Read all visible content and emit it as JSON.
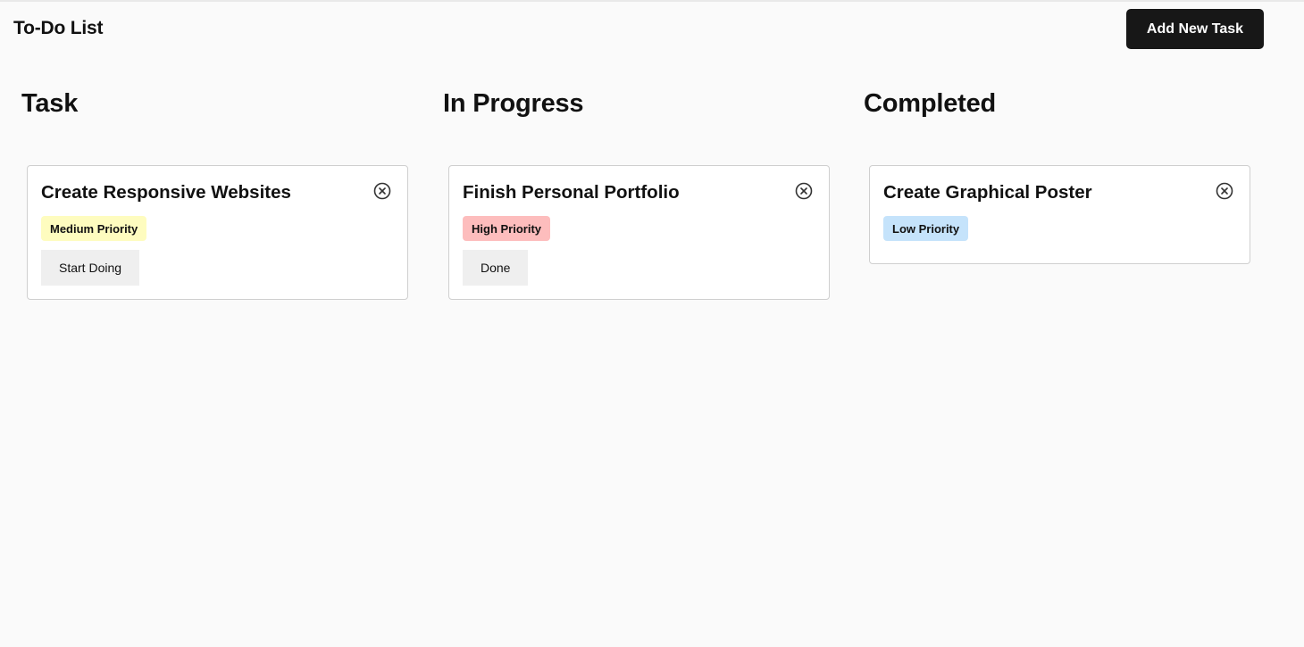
{
  "header": {
    "title": "To-Do List",
    "add_button_label": "Add New Task"
  },
  "columns": [
    {
      "heading": "Task",
      "card": {
        "title": "Create Responsive Websites",
        "priority": "Medium Priority",
        "priority_color": "#fefcbf",
        "action_label": "Start Doing",
        "close_icon": "circle-x-icon"
      }
    },
    {
      "heading": "In Progress",
      "card": {
        "title": "Finish Personal Portfolio",
        "priority": "High Priority",
        "priority_color": "#fdbdbd",
        "action_label": "Done",
        "close_icon": "circle-x-icon"
      }
    },
    {
      "heading": "Completed",
      "card": {
        "title": "Create Graphical Poster",
        "priority": "Low Priority",
        "priority_color": "#c5e3fb",
        "close_icon": "circle-x-icon"
      }
    }
  ],
  "colors": {
    "background": "#fafafa",
    "accent_button": "#171717",
    "action_button": "#efefef"
  }
}
